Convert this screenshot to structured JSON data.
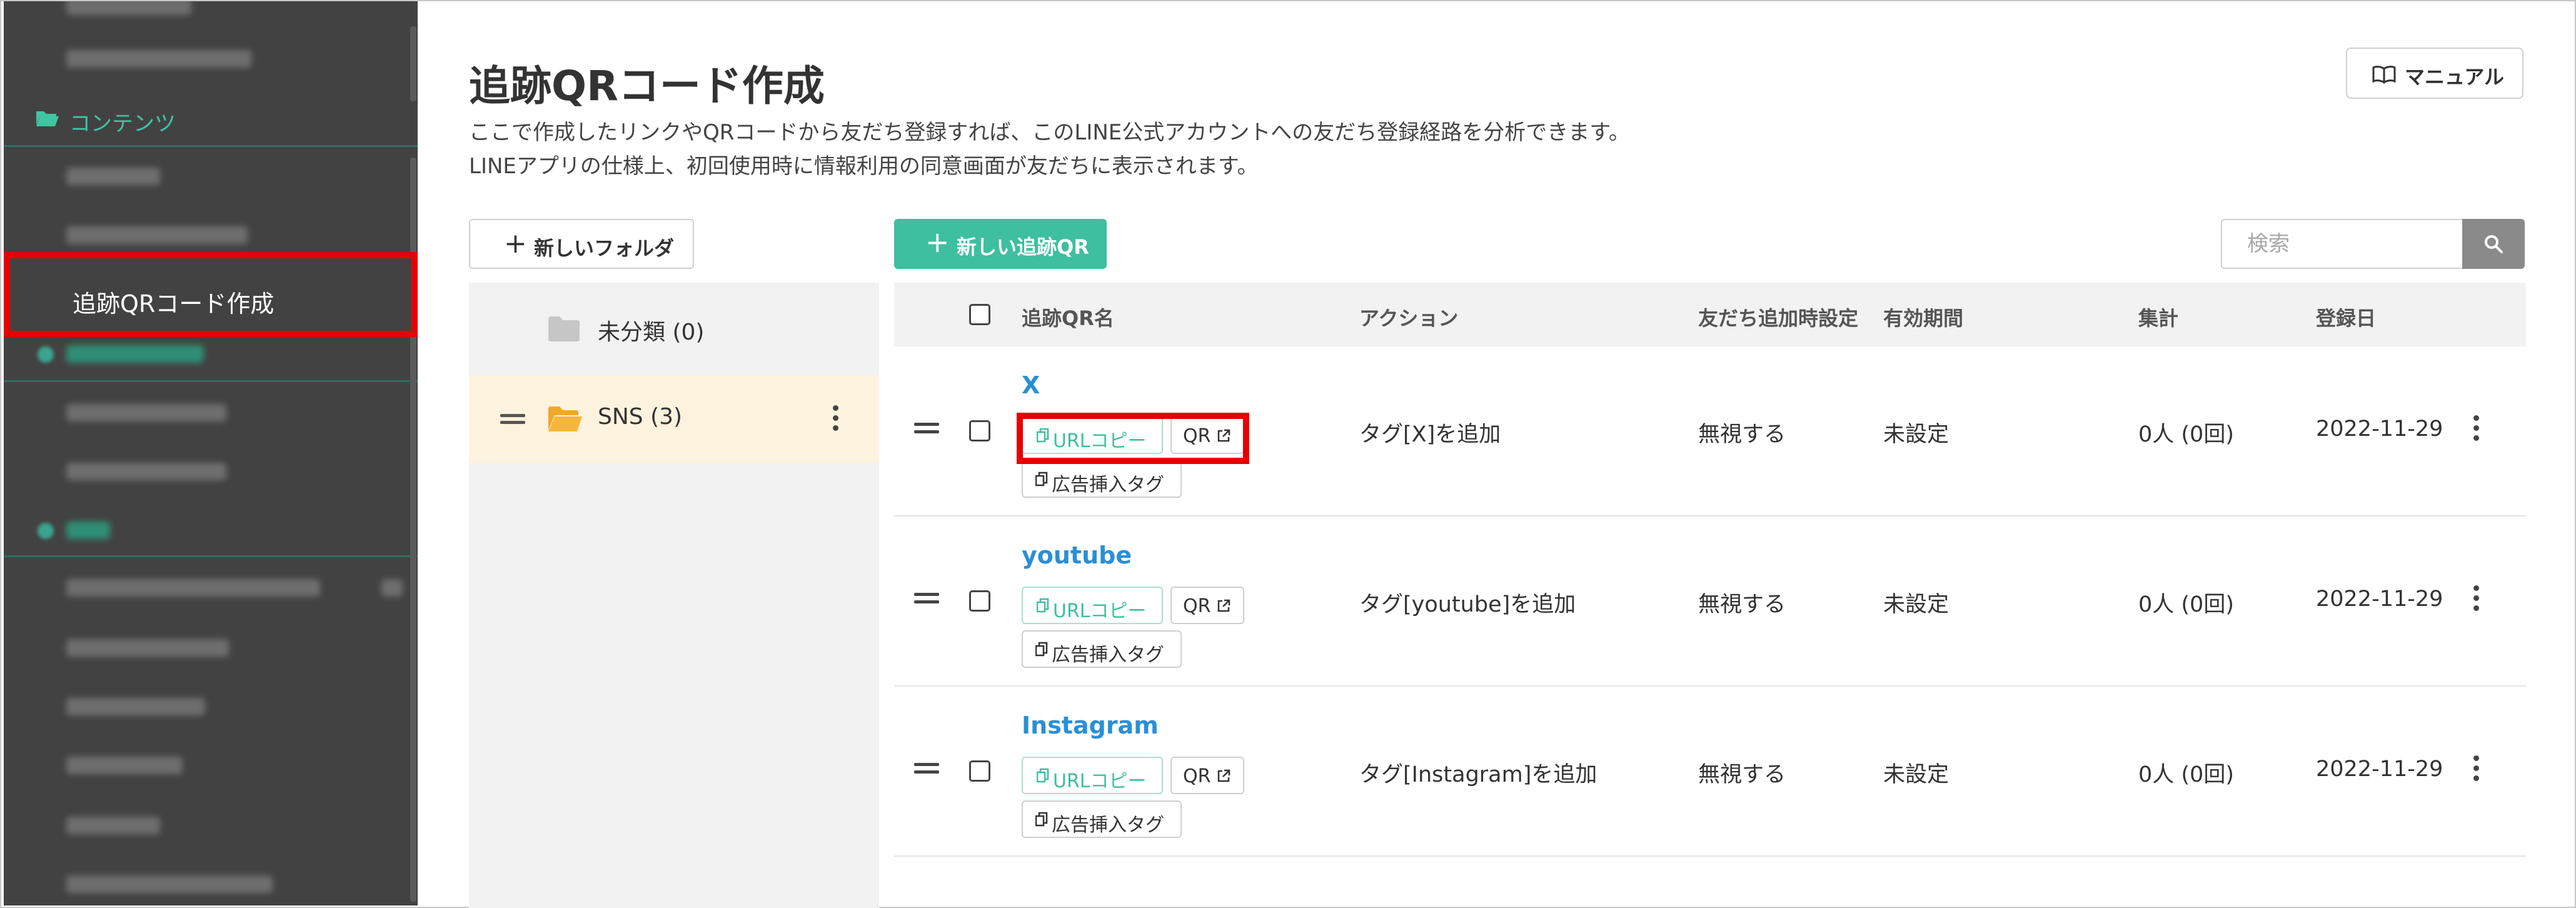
{
  "sidebar": {
    "contents_section": "コンテンツ",
    "active_item": "追跡QRコード作成"
  },
  "header": {
    "title": "追跡QRコード作成",
    "desc_line1": "ここで作成したリンクやQRコードから友だち登録すれば、このLINE公式アカウントへの友だち登録経路を分析できます。",
    "desc_line2": "LINEアプリの仕様上、初回使用時に情報利用の同意画面が友だちに表示されます。",
    "manual_label": "マニュアル"
  },
  "toolbar": {
    "new_folder_label": "新しいフォルダ",
    "new_qr_label": "新しい追跡QR",
    "search_placeholder": "検索"
  },
  "folders": [
    {
      "label": "未分類 (0)"
    },
    {
      "label": "SNS (3)"
    }
  ],
  "table": {
    "headers": {
      "name": "追跡QR名",
      "action": "アクション",
      "friend_setting": "友だち追加時設定",
      "period": "有効期間",
      "total": "集計",
      "date": "登録日"
    },
    "url_copy_label": "URLコピー",
    "qr_label": "QR",
    "ad_tag_label": "広告挿入タグ",
    "rows": [
      {
        "name": "X",
        "action": "タグ[X]を追加",
        "friend_setting": "無視する",
        "period": "未設定",
        "total": "0人 (0回)",
        "date": "2022-11-29"
      },
      {
        "name": "youtube",
        "action": "タグ[youtube]を追加",
        "friend_setting": "無視する",
        "period": "未設定",
        "total": "0人 (0回)",
        "date": "2022-11-29"
      },
      {
        "name": "Instagram",
        "action": "タグ[Instagram]を追加",
        "friend_setting": "無視する",
        "period": "未設定",
        "total": "0人 (0回)",
        "date": "2022-11-29"
      }
    ]
  },
  "colors": {
    "accent": "#3ebf9f",
    "link": "#2a8fd6",
    "highlight": "#e60000",
    "sidebar_bg": "#424242"
  }
}
